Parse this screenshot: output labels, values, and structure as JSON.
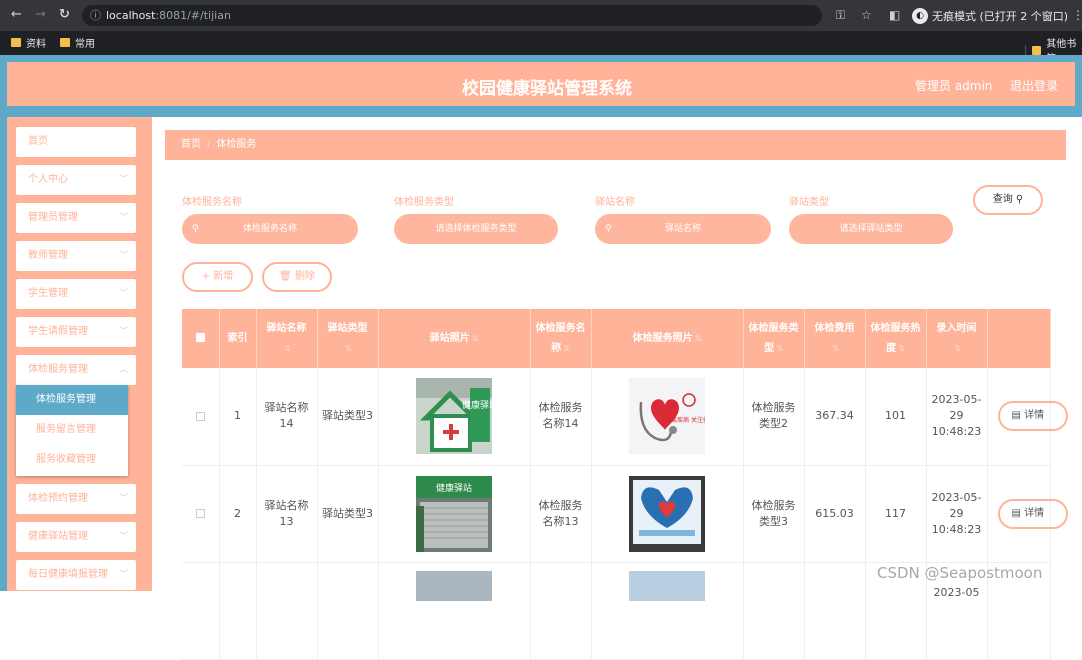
{
  "browser": {
    "url_host": "localhost",
    "url_path": ":8081/#/tijian",
    "incognito_label": "无痕模式 (已打开 2 个窗口)",
    "bookmarks": [
      "资料",
      "常用"
    ],
    "bookmark_right": "其他书签"
  },
  "header": {
    "title": "校园健康驿站管理系统",
    "admin": "管理员 admin",
    "logout": "退出登录"
  },
  "sidebar": {
    "items": [
      {
        "label": "首页"
      },
      {
        "label": "个人中心"
      },
      {
        "label": "管理员管理"
      },
      {
        "label": "教师管理"
      },
      {
        "label": "学生管理"
      },
      {
        "label": "学生请假管理"
      },
      {
        "label": "体检服务管理"
      },
      {
        "label": "体检预约管理"
      },
      {
        "label": "健康驿站管理"
      },
      {
        "label": "每日健康填报管理"
      }
    ],
    "submenu": [
      "体检服务管理",
      "服务留言管理",
      "服务收藏管理"
    ]
  },
  "breadcrumb": {
    "home": "首页",
    "sep": "/",
    "current": "体检服务"
  },
  "filters": [
    {
      "label": "体检服务名称",
      "placeholder": "体检服务名称"
    },
    {
      "label": "体检服务类型",
      "placeholder": "请选择体检服务类型"
    },
    {
      "label": "驿站名称",
      "placeholder": "驿站名称"
    },
    {
      "label": "驿站类型",
      "placeholder": "请选择驿站类型"
    }
  ],
  "actions": {
    "search": "查询",
    "add": "新增",
    "delete": "删除",
    "detail": "详情"
  },
  "table": {
    "columns": [
      "索引",
      "驿站名称",
      "驿站类型",
      "驿站照片",
      "体检服务名称",
      "体检服务照片",
      "体检服务类型",
      "体检费用",
      "体检服务热度",
      "录入时间"
    ],
    "rows": [
      {
        "index": "1",
        "station_name": "驿站名称14",
        "station_type": "驿站类型3",
        "service_name": "体检服务名称14",
        "service_type": "体检服务类型2",
        "fee": "367.34",
        "heat": "101",
        "time": "2023-05-29 10:48:23",
        "station_photo_text": "健康驿站",
        "service_photo_text": "远离疾病 关注健康"
      },
      {
        "index": "2",
        "station_name": "驿站名称13",
        "station_type": "驿站类型3",
        "service_name": "体检服务名称13",
        "service_type": "体检服务类型3",
        "fee": "615.03",
        "heat": "117",
        "time": "2023-05-29 10:48:23",
        "station_photo_text": "健康驿站",
        "service_photo_text": ""
      }
    ],
    "partial_row_time": "2023-05"
  },
  "watermark": "CSDN @Seapostmoon"
}
